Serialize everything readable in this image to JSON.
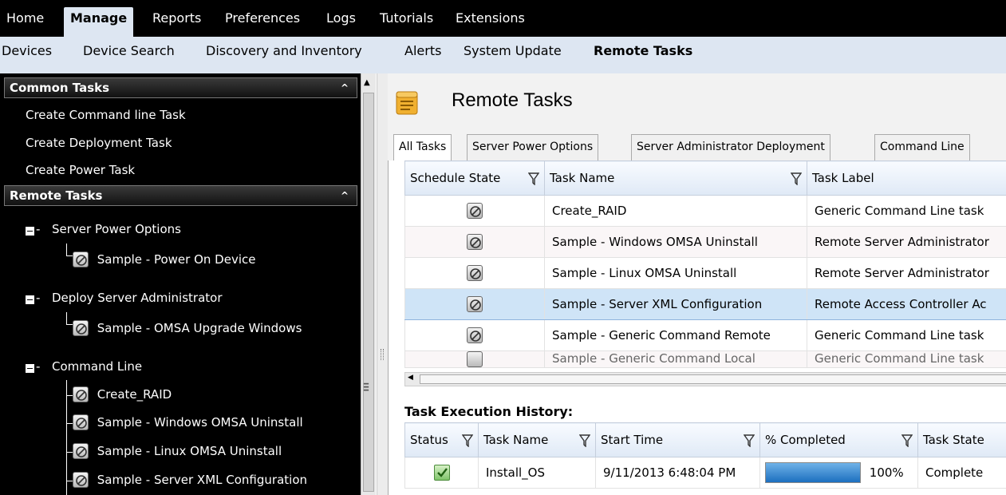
{
  "menubar": {
    "items": [
      "Home",
      "Manage",
      "Reports",
      "Preferences",
      "Logs",
      "Tutorials",
      "Extensions"
    ],
    "active": "Manage"
  },
  "subnav": {
    "items": [
      "Devices",
      "Device Search",
      "Discovery and Inventory",
      "Alerts",
      "System Update",
      "Remote Tasks"
    ],
    "active": "Remote Tasks"
  },
  "left_panel": {
    "common_tasks": {
      "title": "Common Tasks",
      "items": [
        "Create Command line Task",
        "Create Deployment Task",
        "Create Power Task"
      ]
    },
    "remote_tasks": {
      "title": "Remote Tasks",
      "groups": [
        {
          "label": "Server Power Options",
          "children": [
            "Sample - Power On Device"
          ]
        },
        {
          "label": "Deploy Server Administrator",
          "children": [
            "Sample - OMSA Upgrade Windows"
          ]
        },
        {
          "label": "Command Line",
          "children": [
            "Create_RAID",
            "Sample - Windows OMSA Uninstall",
            "Sample - Linux OMSA Uninstall",
            "Sample - Server XML Configuration"
          ]
        }
      ]
    }
  },
  "main": {
    "title": "Remote Tasks",
    "tabs": [
      "All Tasks",
      "Server Power Options",
      "Server Administrator Deployment",
      "Command Line"
    ],
    "active_tab": "All Tasks",
    "tasks_table": {
      "headers": [
        "Schedule State",
        "Task Name",
        "Task Label"
      ],
      "rows": [
        {
          "task_name": "Create_RAID",
          "task_label": "Generic Command Line task"
        },
        {
          "task_name": "Sample - Windows OMSA Uninstall",
          "task_label": "Remote Server Administrator"
        },
        {
          "task_name": "Sample - Linux OMSA Uninstall",
          "task_label": "Remote Server Administrator"
        },
        {
          "task_name": "Sample - Server XML Configuration",
          "task_label": "Remote Access Controller Ac"
        },
        {
          "task_name": "Sample - Generic Command Remote",
          "task_label": "Generic Command Line task"
        },
        {
          "task_name": "Sample - Generic Command Local",
          "task_label": "Generic Command Line task"
        }
      ],
      "selected_row": 3
    },
    "history": {
      "title": "Task Execution History:",
      "headers": [
        "Status",
        "Task Name",
        "Start Time",
        "% Completed",
        "Task State"
      ],
      "rows": [
        {
          "status": "complete",
          "task_name": "Install_OS",
          "start_time": "9/11/2013 6:48:04 PM",
          "percent": "100%",
          "progress_fraction": 1.0,
          "task_state": "Complete"
        }
      ]
    }
  },
  "colors": {
    "menubar_bg": "#000000",
    "subnav_bg": "#dde6f2",
    "selection": "#cfe4f7",
    "progress": "#1c6fbf"
  }
}
